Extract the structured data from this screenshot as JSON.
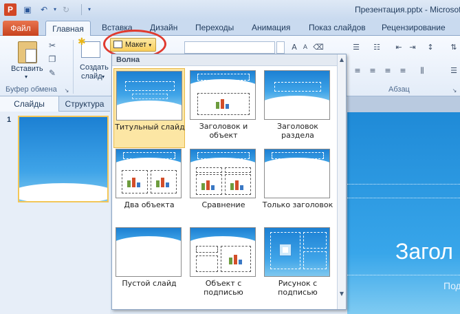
{
  "window": {
    "app_icon_letter": "P",
    "title": "Презентация.pptx - Microsoft"
  },
  "qat": {
    "save_icon": "save-icon",
    "undo_icon": "undo-icon",
    "redo_icon": "redo-icon",
    "customize_icon": "chevron-down-icon"
  },
  "tabs": {
    "file": "Файл",
    "items": [
      "Главная",
      "Вставка",
      "Дизайн",
      "Переходы",
      "Анимация",
      "Показ слайдов",
      "Рецензирование"
    ]
  },
  "ribbon": {
    "paste_label": "Вставить",
    "new_slide_label_1": "Создать",
    "new_slide_label_2": "слайд",
    "clipboard_group": "Буфер обмена",
    "paragraph_group": "Абзац",
    "layout_button": "Макет"
  },
  "panel": {
    "tab_slides": "Слайды",
    "tab_outline": "Структура",
    "slide_number": "1"
  },
  "main_slide": {
    "title": "Загол",
    "subtitle": "Под"
  },
  "layout_gallery": {
    "theme_name": "Волна",
    "layouts": [
      {
        "line1": "Титульный слайд",
        "line2": ""
      },
      {
        "line1": "Заголовок и",
        "line2": "объект"
      },
      {
        "line1": "Заголовок",
        "line2": "раздела"
      },
      {
        "line1": "Два объекта",
        "line2": ""
      },
      {
        "line1": "Сравнение",
        "line2": ""
      },
      {
        "line1": "Только заголовок",
        "line2": ""
      },
      {
        "line1": "Пустой слайд",
        "line2": ""
      },
      {
        "line1": "Объект с",
        "line2": "подписью"
      },
      {
        "line1": "Рисунок с",
        "line2": "подписью"
      }
    ],
    "selected_index": 0
  },
  "colors": {
    "file_tab": "#d24726",
    "selection": "#fce6a4",
    "highlight_circle": "#e03a2f",
    "slide_blue": "#1f8ad7"
  }
}
